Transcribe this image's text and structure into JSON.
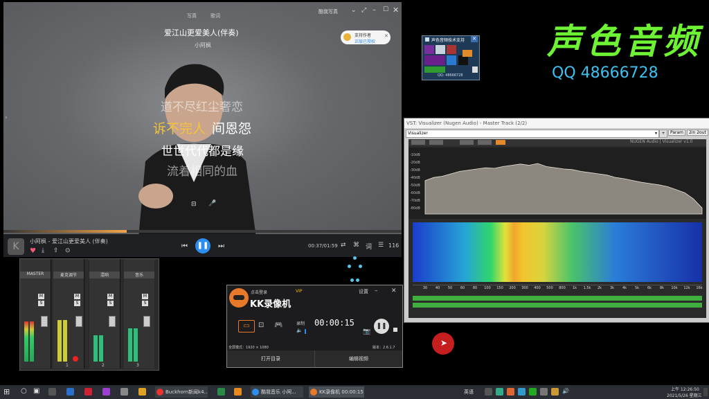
{
  "player": {
    "top_icons": [
      "写真",
      "歌词"
    ],
    "song_title": "爱江山更爱美人(伴奏)",
    "artist": "小阿枫",
    "lyrics": [
      "道不尽红尘奢恋",
      "诉不完人",
      "间恩怨",
      "世世代代都是缘",
      "流着相同的血"
    ],
    "brand_btn": "酷我写真",
    "tip_line1": "支持作者",
    "tip_line2": "正版已授权",
    "now_playing": "小阿枫 - 爱江山更爱美人 (伴奏)",
    "time": "00:37/01:59",
    "count": "116",
    "progress": 0.31,
    "accent": "#2e8ef0"
  },
  "mixer": {
    "channels": [
      {
        "label": "MASTER",
        "num": ""
      },
      {
        "label": "麦克调节",
        "num": "1"
      },
      {
        "label": "混响",
        "num": "2"
      },
      {
        "label": "音乐",
        "num": "3"
      }
    ],
    "ms": [
      "M",
      "S"
    ]
  },
  "kk": {
    "title": "点击登录",
    "vip": "VIP",
    "settings": "设置",
    "app_name": "KK录像机",
    "record_label": "录制",
    "timer": "00:00:15",
    "resolution": "全屏模式：1920 × 1080",
    "version": "版本：2.6.1.7",
    "btn_left": "打开目录",
    "btn_right": "编辑视频"
  },
  "widget": {
    "title": "声色音频技术支持",
    "footer": "QQ: 48666728"
  },
  "brand": {
    "name": "声色音频",
    "qq": "QQ 48666728",
    "color": "#6ef234",
    "qq_color": "#3ec0f0"
  },
  "viz": {
    "title": "VST: Visualizer (Nugen Audio) - Master Track (2/2)",
    "preset": "Visualizer",
    "param": "Param",
    "io": "2in 2out",
    "logo": "NUGEN Audio | Visualizer v1.0",
    "db_labels": [
      "-10dB",
      "-20dB",
      "-30dB",
      "-40dB",
      "-50dB",
      "-60dB",
      "-70dB",
      "-80dB"
    ],
    "freq_labels": [
      "30",
      "40",
      "50",
      "60",
      "80",
      "100",
      "150",
      "200",
      "300",
      "400",
      "500",
      "800",
      "1k",
      "1.5k",
      "2k",
      "3k",
      "4k",
      "5k",
      "6k",
      "8k",
      "10k",
      "12k",
      "16k"
    ],
    "spectrum": [
      0.55,
      0.6,
      0.62,
      0.66,
      0.7,
      0.72,
      0.74,
      0.76,
      0.75,
      0.78,
      0.8,
      0.82,
      0.8,
      0.83,
      0.78,
      0.76,
      0.74,
      0.73,
      0.7,
      0.68,
      0.66,
      0.64,
      0.6,
      0.58,
      0.55,
      0.52,
      0.5,
      0.48,
      0.45,
      0.4,
      0.35,
      0.25,
      0.1
    ]
  },
  "taskbar": {
    "items": [
      "Buckhorn新闻k4...",
      "酷我音乐 小阿...",
      "KK录像机 00:00:15"
    ],
    "time": "上午 12:26:50",
    "date": "2021/5/26 星期三",
    "lang": "英语"
  }
}
